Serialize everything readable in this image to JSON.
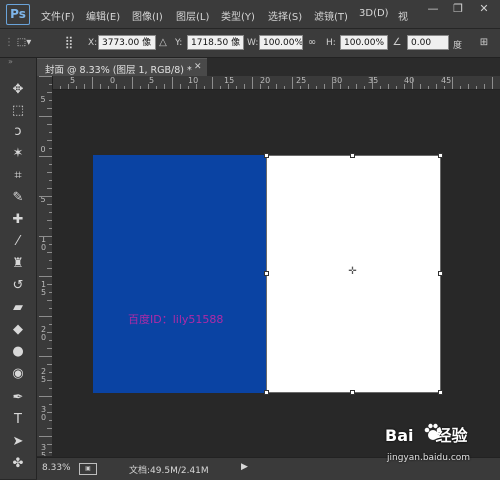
{
  "app": {
    "logo": "Ps"
  },
  "menu": {
    "items": [
      "文件(F)",
      "编辑(E)",
      "图像(I)",
      "图层(L)",
      "类型(Y)",
      "选择(S)",
      "滤镜(T)",
      "3D(D)",
      "视"
    ],
    "window_buttons": [
      "minimize-icon",
      "restore-icon",
      "close-icon"
    ]
  },
  "options_bar": {
    "x_label": "X:",
    "x_value": "3773.00 像",
    "y_label": "Y:",
    "y_value": "1718.50 像",
    "w_label": "W:",
    "w_value": "100.00%",
    "h_label": "H:",
    "h_value": "100.00%",
    "angle_value": "0.00",
    "angle_unit": "度"
  },
  "toolbar": {
    "tools": [
      "move-tool-icon",
      "marquee-tool-icon",
      "lasso-tool-icon",
      "magic-wand-icon",
      "crop-tool-icon",
      "eyedropper-icon",
      "healing-brush-icon",
      "brush-tool-icon",
      "clone-stamp-icon",
      "history-brush-icon",
      "eraser-icon",
      "paint-bucket-icon",
      "blur-tool-icon",
      "dodge-tool-icon",
      "pen-tool-icon",
      "type-tool-icon",
      "path-select-icon",
      "custom-shape-icon"
    ]
  },
  "document": {
    "tab_title": "封面 @ 8.33% (图层 1, RGB/8) *",
    "watermark_text": "百度ID：lily51588",
    "colors": {
      "left_panel": "#0a43a3",
      "right_panel": "#ffffff",
      "watermark": "#b02aa6"
    }
  },
  "rulers": {
    "top_labels": [
      "5",
      "0",
      "5",
      "10",
      "15",
      "20",
      "25",
      "30",
      "35",
      "40",
      "45"
    ],
    "left_labels": [
      "5",
      "0",
      "5",
      "1 0",
      "1 5",
      "2 0",
      "2 5",
      "3 0",
      "3 5"
    ]
  },
  "status": {
    "zoom": "8.33%",
    "doc_info": "文档:49.5M/2.41M"
  },
  "baidu": {
    "logo_left": "Bai",
    "logo_right": "经验",
    "url": "jingyan.baidu.com"
  }
}
